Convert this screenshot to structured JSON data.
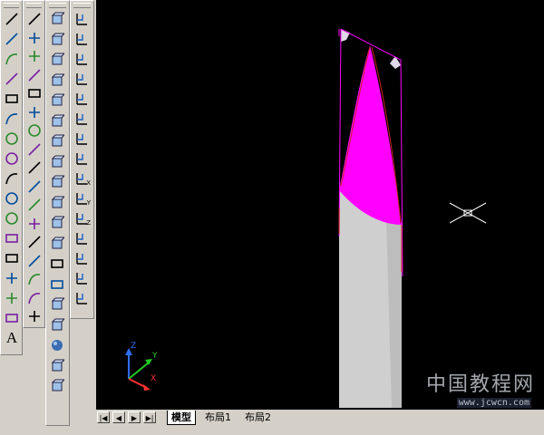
{
  "toolbars": {
    "draw": [
      "line-icon",
      "construction-line-icon",
      "polyline-icon",
      "polygon-icon",
      "rectangle-icon",
      "arc-icon",
      "circle-icon",
      "revision-cloud-icon",
      "spline-icon",
      "ellipse-icon",
      "ellipse-arc-icon",
      "insert-block-icon",
      "make-block-icon",
      "point-icon",
      "hatch-icon",
      "region-icon",
      "multiline-text-icon"
    ],
    "draw_text_glyph": "A",
    "modify": [
      "erase-icon",
      "copy-icon",
      "mirror-icon",
      "offset-icon",
      "array-icon",
      "move-icon",
      "rotate-icon",
      "scale-icon",
      "stretch-icon",
      "trim-icon",
      "extend-icon",
      "break-at-point-icon",
      "break-icon",
      "join-icon",
      "chamfer-icon",
      "fillet-icon",
      "explode-icon"
    ],
    "view": [
      "named-views-icon",
      "top-view-icon",
      "bottom-view-icon",
      "left-view-icon",
      "right-view-icon",
      "front-view-icon",
      "back-view-icon",
      "sw-iso-icon",
      "se-iso-icon",
      "ne-iso-icon",
      "nw-iso-icon",
      "camera-icon",
      "region-render-icon",
      "tool-palette-icon",
      "wire-cube-icon",
      "solid-box-icon",
      "sphere-icon",
      "box-icon",
      "cone-icon"
    ],
    "ucs": [
      "ucs-icon",
      "ucs-previous-icon",
      "ucs-face-icon",
      "ucs-object-icon",
      "ucs-view-icon",
      "ucs-origin-icon",
      "ucs-zaxis-icon",
      "ucs-3point-icon",
      "ucs-x-icon",
      "ucs-y-icon",
      "ucs-z-icon",
      "ucs-apply-icon",
      "named-ucs-icon",
      "ucs-manager-icon",
      "ucs-settings-icon"
    ],
    "ucs_digits": [
      "",
      "",
      "",
      "",
      "",
      "",
      "",
      "",
      "X",
      "Y",
      "Z",
      "",
      "",
      "",
      ""
    ]
  },
  "viewport": {
    "background": "#000000",
    "model_colors": {
      "surface": "#cfcfcf",
      "magenta": "#ff00ff",
      "edge": "#cc2222"
    },
    "ucs_labels": {
      "z": "Z",
      "y": "Y",
      "x": "X"
    }
  },
  "layout_tabs": {
    "nav": [
      "first-tab-button",
      "prev-tab-button",
      "next-tab-button",
      "last-tab-button"
    ],
    "tabs": [
      {
        "label": "模型",
        "active": true
      },
      {
        "label": "布局1",
        "active": false
      },
      {
        "label": "布局2",
        "active": false
      }
    ]
  },
  "watermark": {
    "text": "中国教程网",
    "url": "www.jcwcn.com"
  }
}
